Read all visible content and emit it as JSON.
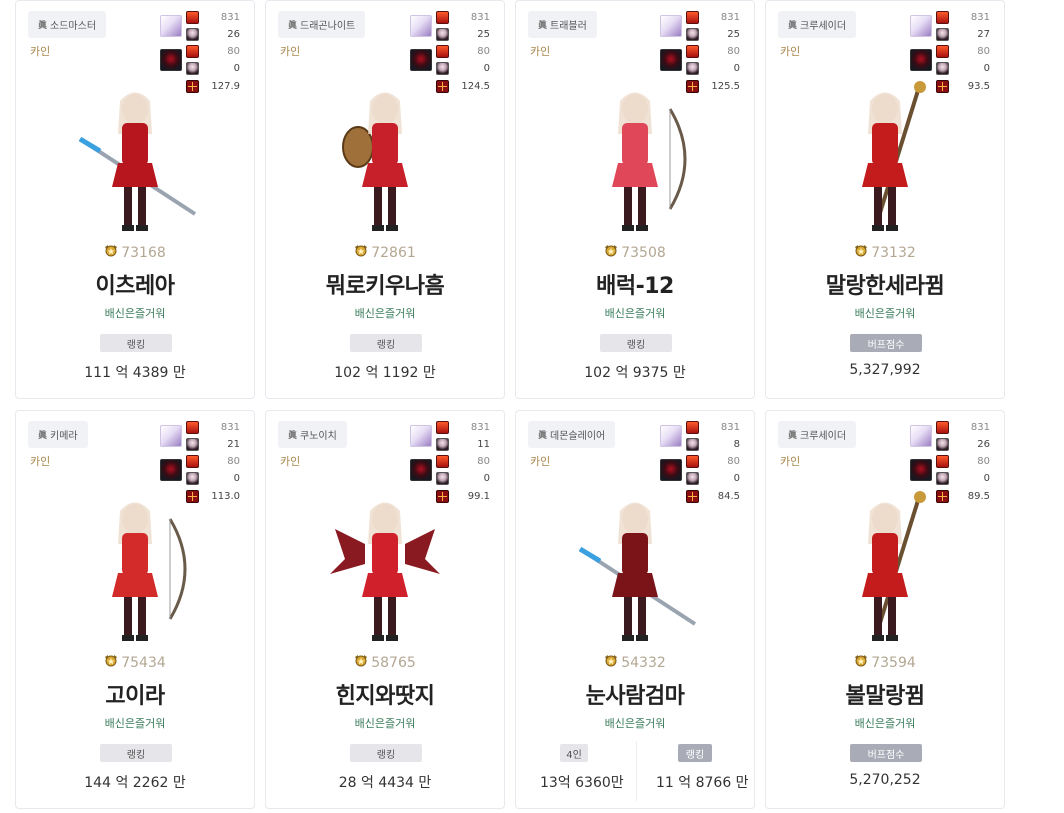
{
  "cards": [
    {
      "class_name": "소드마스터",
      "server": "카인",
      "slot1": "831",
      "slot2": "26",
      "slot3": "80",
      "slot4": "0",
      "fame_val": "127.9",
      "fame": "73168",
      "name": "이츠레아",
      "guild": "배신은즐거워",
      "mode": "single",
      "badge": "랭킹",
      "badge_style": "gray",
      "stat": "111 억 4389 만",
      "outfit": "#b8161f",
      "weapon": "sword"
    },
    {
      "class_name": "드래곤나이트",
      "server": "카인",
      "slot1": "831",
      "slot2": "25",
      "slot3": "80",
      "slot4": "0",
      "fame_val": "124.5",
      "fame": "72861",
      "name": "뭐로키우나흠",
      "guild": "배신은즐거워",
      "mode": "single",
      "badge": "랭킹",
      "badge_style": "gray",
      "stat": "102 억 1192 만",
      "outfit": "#c8202a",
      "weapon": "shield"
    },
    {
      "class_name": "트래블러",
      "server": "카인",
      "slot1": "831",
      "slot2": "25",
      "slot3": "80",
      "slot4": "0",
      "fame_val": "125.5",
      "fame": "73508",
      "name": "배럭-12",
      "guild": "배신은즐거워",
      "mode": "single",
      "badge": "랭킹",
      "badge_style": "gray",
      "stat": "102 억 9375 만",
      "outfit": "#e0485a",
      "weapon": "bow"
    },
    {
      "class_name": "크루세이더",
      "server": "카인",
      "slot1": "831",
      "slot2": "27",
      "slot3": "80",
      "slot4": "0",
      "fame_val": "93.5",
      "fame": "73132",
      "name": "말랑한세라뀜",
      "guild": "배신은즐거워",
      "mode": "single",
      "badge": "버프점수",
      "badge_style": "dark",
      "stat": "5,327,992",
      "outfit": "#c41c1c",
      "weapon": "staff"
    },
    {
      "class_name": "키메라",
      "server": "카인",
      "slot1": "831",
      "slot2": "21",
      "slot3": "80",
      "slot4": "0",
      "fame_val": "113.0",
      "fame": "75434",
      "name": "고이라",
      "guild": "배신은즐거워",
      "mode": "single",
      "badge": "랭킹",
      "badge_style": "gray",
      "stat": "144 억 2262 만",
      "outfit": "#d32a2a",
      "weapon": "bow"
    },
    {
      "class_name": "쿠노이치",
      "server": "카인",
      "slot1": "831",
      "slot2": "11",
      "slot3": "80",
      "slot4": "0",
      "fame_val": "99.1",
      "fame": "58765",
      "name": "힌지와땃지",
      "guild": "배신은즐거워",
      "mode": "single",
      "badge": "랭킹",
      "badge_style": "gray",
      "stat": "28 억 4434 만",
      "outfit": "#d0202c",
      "weapon": "wings"
    },
    {
      "class_name": "데몬슬레이어",
      "server": "카인",
      "slot1": "831",
      "slot2": "8",
      "slot3": "80",
      "slot4": "0",
      "fame_val": "84.5",
      "fame": "54332",
      "name": "눈사람검마",
      "guild": "배신은즐거워",
      "mode": "split",
      "badge_l": "4인",
      "badge_r": "랭킹",
      "stat_l": "13억 6360만",
      "stat_r": "11 억 8766 만",
      "outfit": "#7a1418",
      "weapon": "sword"
    },
    {
      "class_name": "크루세이더",
      "server": "카인",
      "slot1": "831",
      "slot2": "26",
      "slot3": "80",
      "slot4": "0",
      "fame_val": "89.5",
      "fame": "73594",
      "name": "볼말랑뀜",
      "guild": "배신은즐거워",
      "mode": "single",
      "badge": "버프점수",
      "badge_style": "dark",
      "stat": "5,270,252",
      "outfit": "#c41c1c",
      "weapon": "staff"
    }
  ]
}
